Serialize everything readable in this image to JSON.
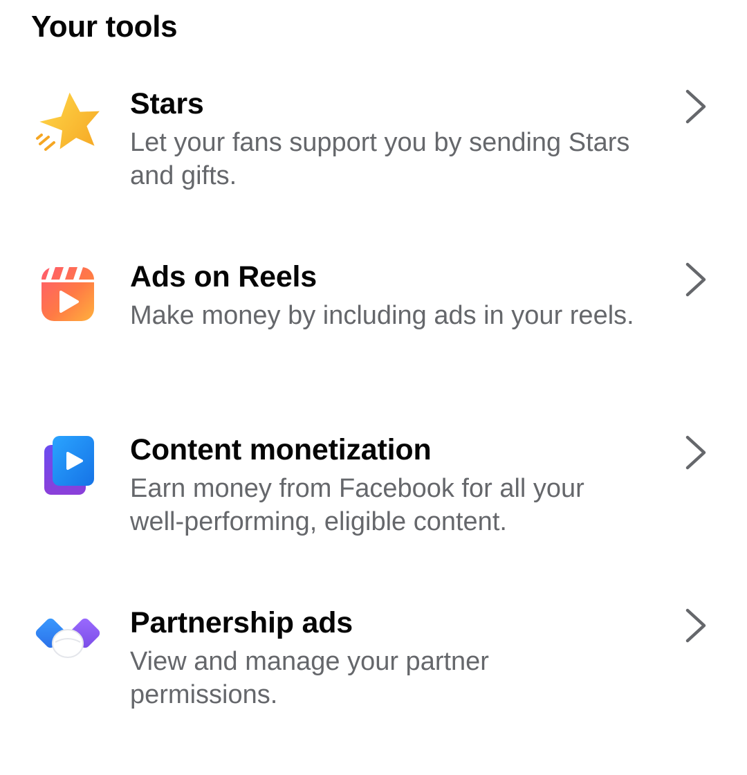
{
  "section": {
    "title": "Your tools"
  },
  "tools": [
    {
      "title": "Stars",
      "description": "Let your fans support you by sending Stars and gifts.",
      "icon": "star-icon",
      "accent": "#f7b924"
    },
    {
      "title": "Ads on Reels",
      "description": "Make money by including ads in your reels.",
      "icon": "reels-icon",
      "accent": "#f5533d"
    },
    {
      "title": "Content monetization",
      "description": "Earn money from Facebook for all your well-performing, eligible content.",
      "icon": "video-play-icon",
      "accent": "#1b74e4"
    },
    {
      "title": "Partnership ads",
      "description": "View and manage your partner permissions.",
      "icon": "handshake-icon",
      "accent": "#8a5cf6"
    }
  ],
  "colors": {
    "title_text": "#050505",
    "secondary_text": "#65676b",
    "chevron": "#65676b",
    "background": "#ffffff"
  }
}
